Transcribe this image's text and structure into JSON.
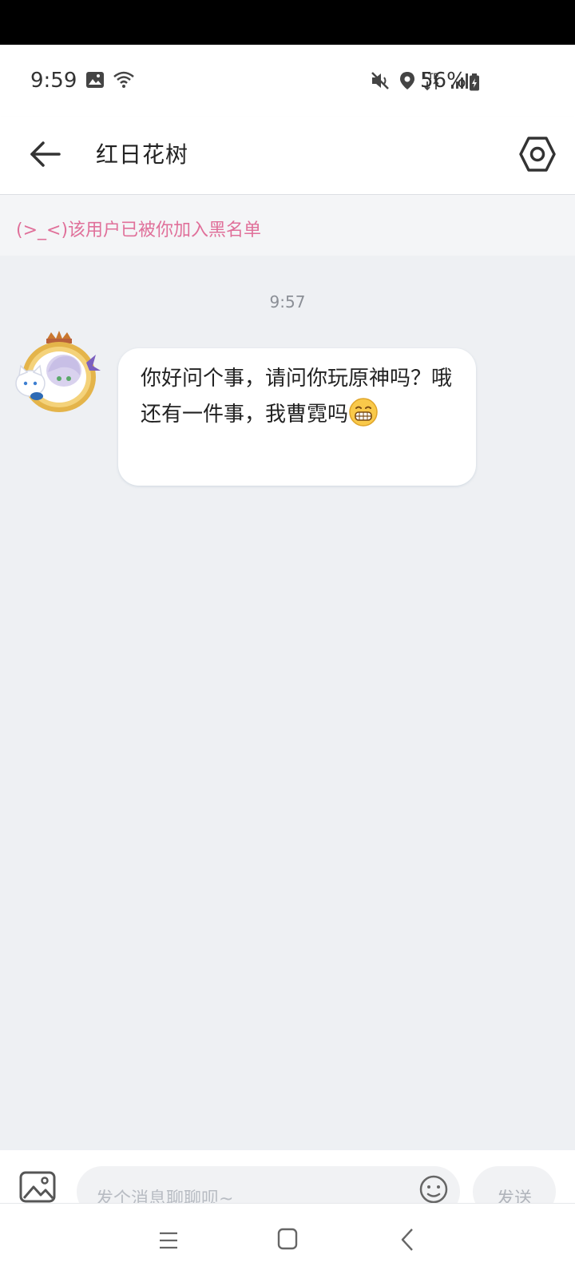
{
  "status_bar": {
    "time": "9:59",
    "battery": "56%",
    "network": "LTE",
    "icons": [
      "image-icon",
      "wifi-icon",
      "mute-icon",
      "location-icon",
      "lte-icon",
      "signal-icon",
      "battery-icon"
    ]
  },
  "header": {
    "title": "红日花树",
    "back_icon": "arrow-left-icon",
    "settings_icon": "hexagon-settings-icon"
  },
  "banner": {
    "text": "(>_<)该用户已被你加入黑名单",
    "color": "#e0709a"
  },
  "chat": {
    "timestamp": "9:57",
    "messages": [
      {
        "sender": "other",
        "text": "你好问个事，请问你玩原神吗？哦还有一件事，我曹霓吗",
        "emoji": "grinning-face-emoji"
      }
    ]
  },
  "input": {
    "placeholder": "发个消息聊聊呗~",
    "value": "",
    "send_label": "发送",
    "image_icon": "image-picker-icon",
    "emoji_icon": "smiley-icon"
  },
  "nav": {
    "icons": [
      "recents-icon",
      "home-icon",
      "back-icon"
    ]
  }
}
